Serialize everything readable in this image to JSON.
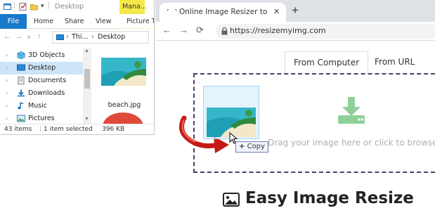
{
  "explorer": {
    "title": "Desktop",
    "manage_label": "Mana...",
    "ribbon_tabs": [
      "File",
      "Home",
      "Share",
      "View",
      "Picture Tools"
    ],
    "breadcrumb": [
      "Thi...",
      "Desktop"
    ],
    "nav_items": [
      {
        "label": "3D Objects",
        "icon": "cube-icon",
        "selected": false
      },
      {
        "label": "Desktop",
        "icon": "desktop-icon",
        "selected": true
      },
      {
        "label": "Documents",
        "icon": "documents-icon",
        "selected": false
      },
      {
        "label": "Downloads",
        "icon": "downloads-icon",
        "selected": false
      },
      {
        "label": "Music",
        "icon": "music-icon",
        "selected": false
      },
      {
        "label": "Pictures",
        "icon": "pictures-icon",
        "selected": false
      }
    ],
    "file_name": "beach.jpg",
    "status": {
      "items": "43 items",
      "selected": "1 item selected",
      "size": "396 KB"
    }
  },
  "browser": {
    "tab_title": "Online Image Resizer to edit, cro",
    "url": "https://resizemyimg.com",
    "site_tabs": [
      "From Computer",
      "From URL"
    ],
    "active_site_tab": "From Computer",
    "drop_text": "Drag your image here or click to browse one",
    "heading": "Easy Image Resize"
  },
  "drag": {
    "tooltip": "Copy",
    "tooltip_symbol": "+"
  },
  "colors": {
    "file_tab": "#1979ca",
    "manage_tab": "#f5e84a",
    "selected_nav": "#cce4f7",
    "dropzone_border": "#4a3f6b",
    "download_icon": "#8fcf9a",
    "drag_arrow": "#c61a16"
  }
}
